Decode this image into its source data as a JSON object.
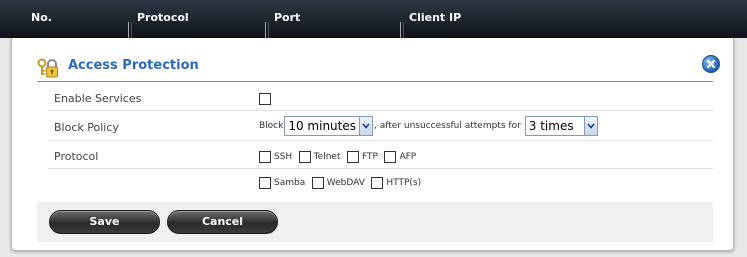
{
  "table_header": {
    "columns": [
      "No.",
      "Protocol",
      "Port",
      "Client IP"
    ]
  },
  "dialog": {
    "title": "Access Protection",
    "rows": {
      "enable_services": {
        "label": "Enable Services",
        "checked": false
      },
      "block_policy": {
        "label": "Block Policy",
        "prefix": "Block",
        "duration_value": "10 minutes",
        "middle_text": ", after unsuccessful attempts for",
        "attempts_value": "3 times"
      },
      "protocol": {
        "label": "Protocol",
        "options_row1": [
          "SSH",
          "Telnet",
          "FTP",
          "AFP"
        ],
        "options_row2": [
          "Samba",
          "WebDAV",
          "HTTP(s)"
        ]
      }
    },
    "buttons": {
      "save": "Save",
      "cancel": "Cancel"
    }
  },
  "icons": {
    "lock": "lock-key-icon",
    "close": "close-icon"
  },
  "colors": {
    "header_bg": "#1a2129",
    "title": "#2a6ab8",
    "close": "#2e75c4"
  }
}
